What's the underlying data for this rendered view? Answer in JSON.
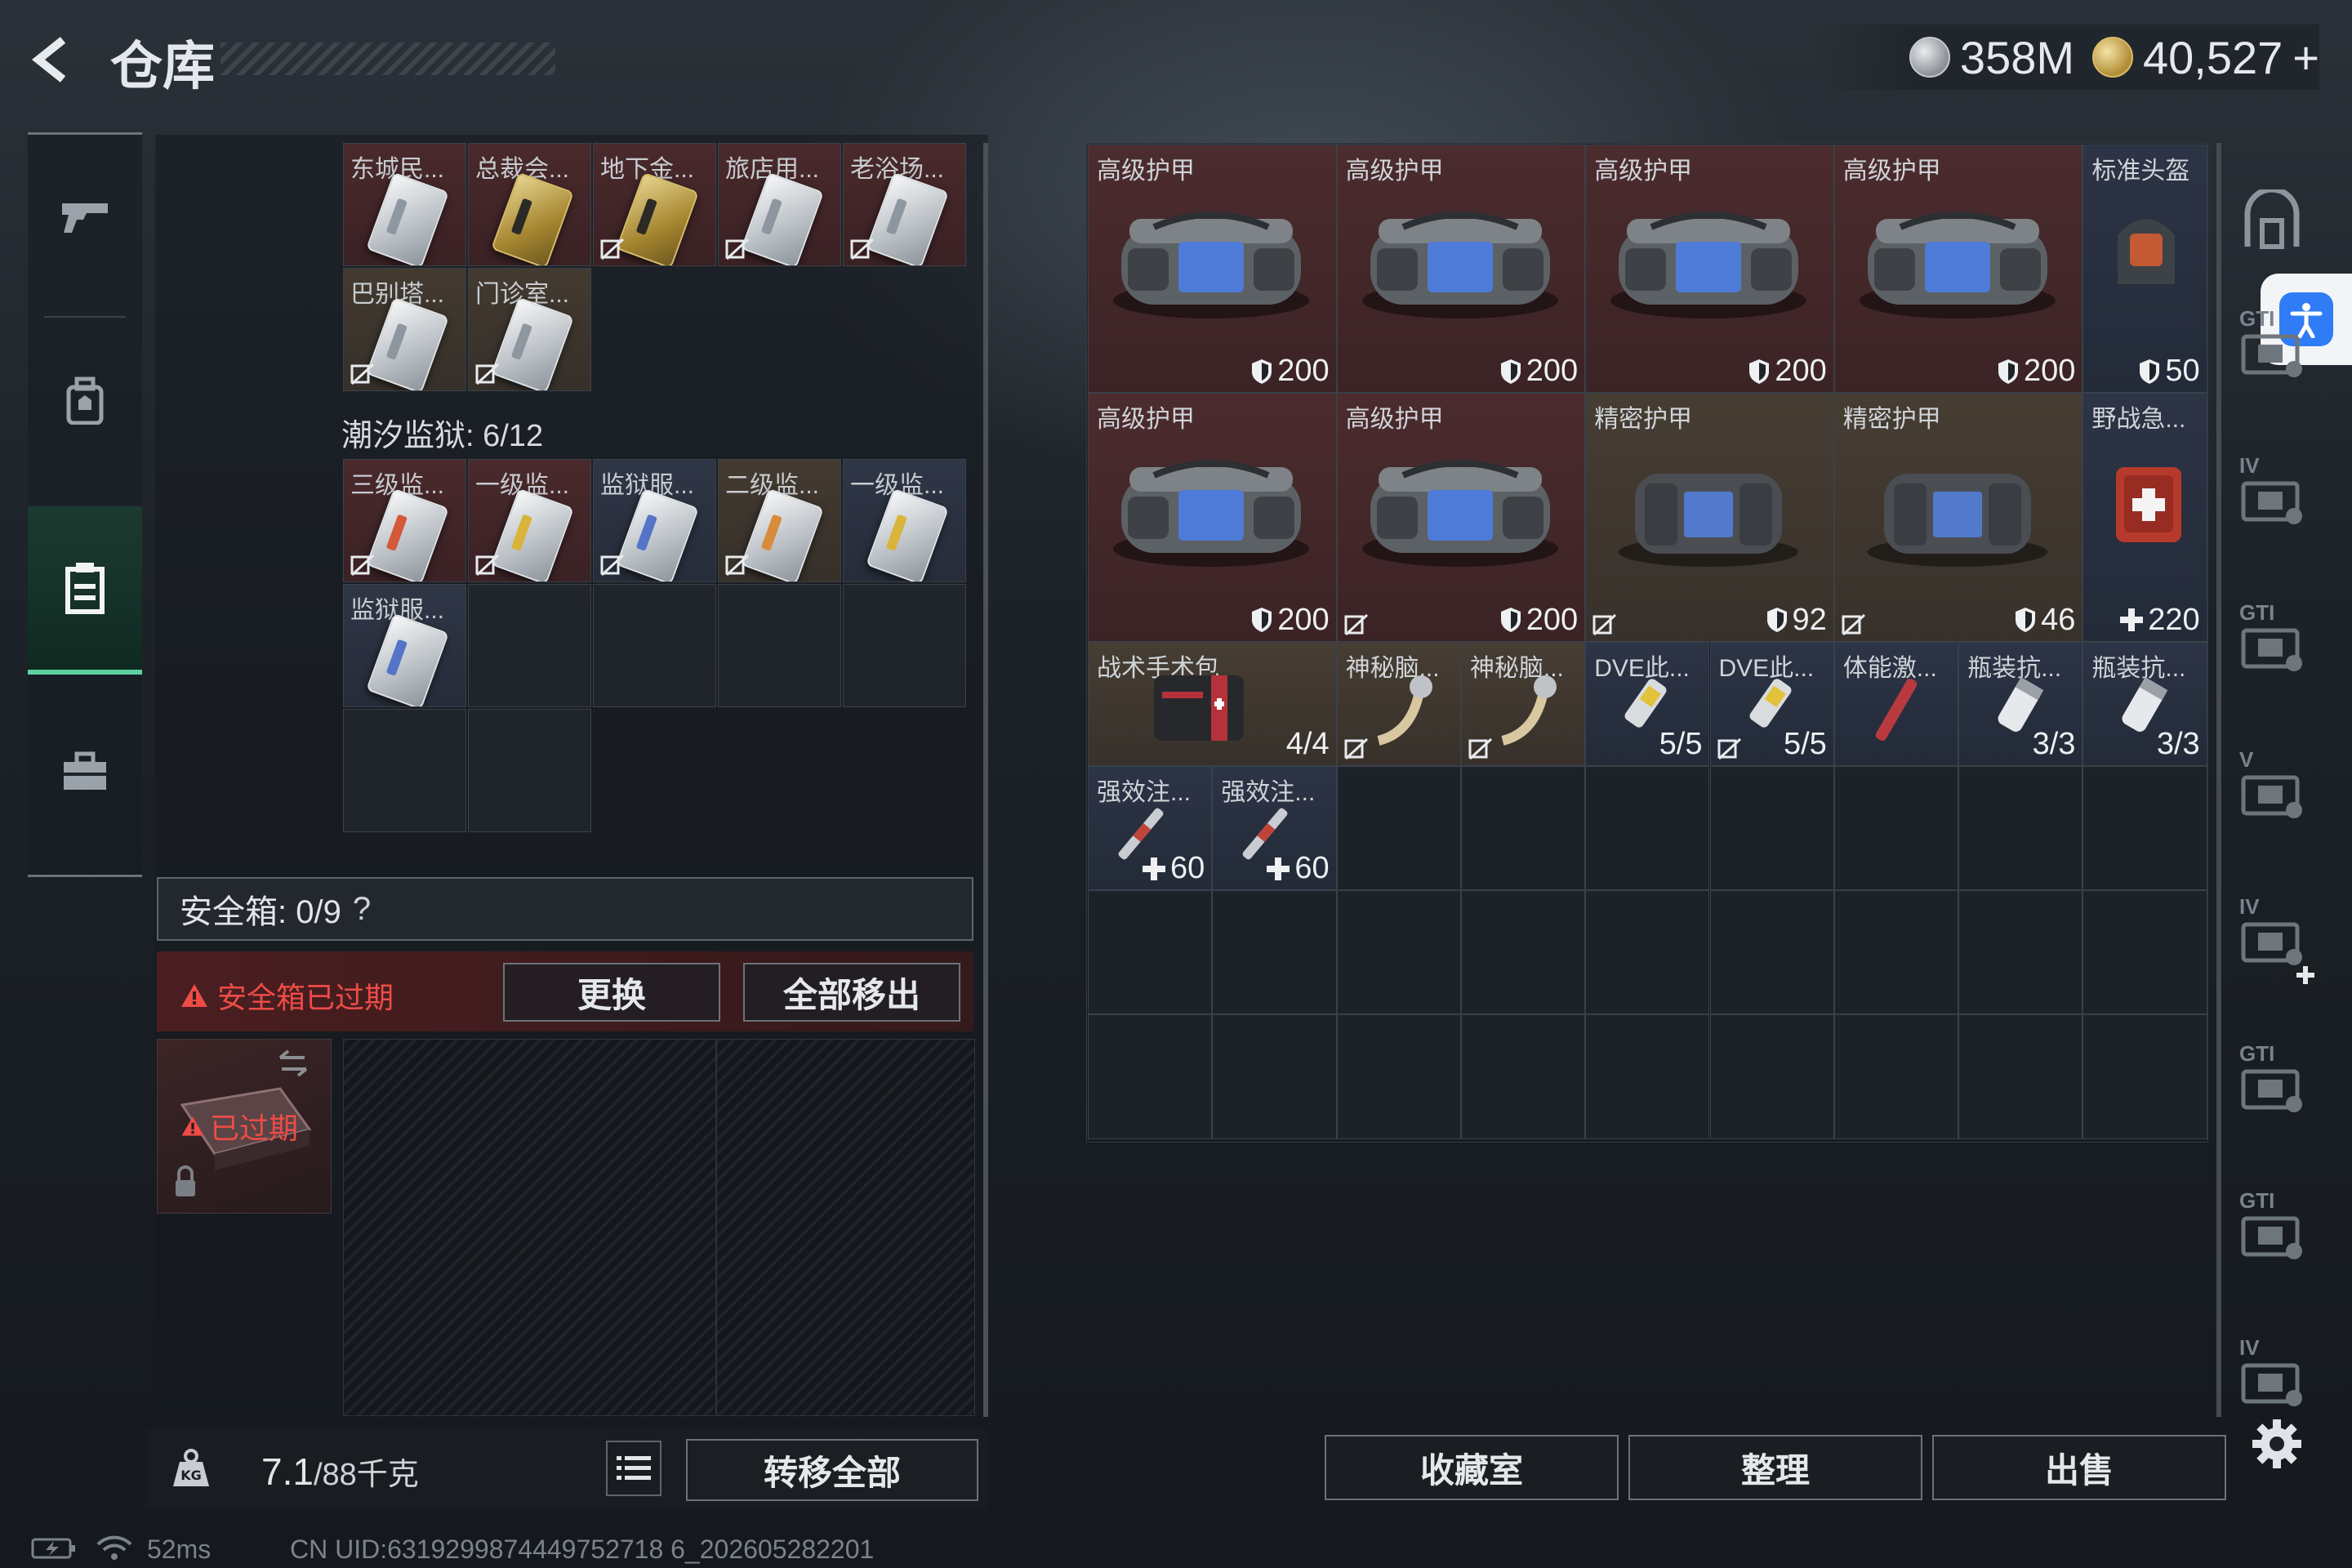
{
  "header": {
    "title": "仓库",
    "currency_silver": "358M",
    "currency_gold": "40,527",
    "gold_plus": "+"
  },
  "left": {
    "keys_top": [
      {
        "label": "东城民...",
        "style": "silver",
        "bg": "red"
      },
      {
        "label": "总裁会...",
        "style": "gold",
        "bg": "red"
      },
      {
        "label": "地下金...",
        "style": "gold",
        "bg": "red"
      },
      {
        "label": "旅店用...",
        "style": "silver",
        "bg": "red"
      },
      {
        "label": "老浴场...",
        "style": "silver",
        "bg": "red"
      },
      {
        "label": "巴别塔...",
        "style": "silver",
        "bg": "brown"
      },
      {
        "label": "门诊室...",
        "style": "silver",
        "bg": "brown"
      }
    ],
    "section_label": "潮汐监狱: 6/12",
    "keys_prison": [
      {
        "label": "三级监...",
        "stripe": "red",
        "bg": "red"
      },
      {
        "label": "一级监...",
        "stripe": "yellow",
        "bg": "red"
      },
      {
        "label": "监狱服...",
        "stripe": "blue",
        "bg": "blue"
      },
      {
        "label": "二级监...",
        "stripe": "orange",
        "bg": "brown"
      },
      {
        "label": "一级监...",
        "stripe": "yellow",
        "bg": "blue"
      },
      {
        "label": "监狱服...",
        "stripe": "blue",
        "bg": "blue"
      }
    ],
    "safe_box_label": "安全箱: 0/9",
    "safe_help": "?",
    "expired_notice": "安全箱已过期",
    "replace_button": "更换",
    "move_all_out_button": "全部移出",
    "case_expired": "已过期",
    "weight_value": "7.1",
    "weight_max": "/88千克",
    "transfer_all_button": "转移全部"
  },
  "stash": {
    "row1": [
      {
        "label": "高级护甲",
        "value": "200",
        "kind": "armor",
        "bg": "red"
      },
      {
        "label": "高级护甲",
        "value": "200",
        "kind": "armor",
        "bg": "red"
      },
      {
        "label": "高级护甲",
        "value": "200",
        "kind": "armor",
        "bg": "red"
      },
      {
        "label": "高级护甲",
        "value": "200",
        "kind": "armor",
        "bg": "red"
      },
      {
        "label": "标准头盔",
        "value": "50",
        "kind": "helmet",
        "bg": "navy"
      }
    ],
    "row2": [
      {
        "label": "高级护甲",
        "value": "200",
        "kind": "armor",
        "bg": "red"
      },
      {
        "label": "高级护甲",
        "value": "200",
        "kind": "armor",
        "bg": "red"
      },
      {
        "label": "精密护甲",
        "value": "92",
        "kind": "armor2",
        "bg": "brown"
      },
      {
        "label": "精密护甲",
        "value": "46",
        "kind": "armor2",
        "bg": "brown"
      },
      {
        "label": "野战急...",
        "value": "220",
        "kind": "medkit",
        "bg": "navy"
      }
    ],
    "row3": [
      {
        "label": "战术手术包",
        "value": "4/4",
        "bg": "brown"
      },
      {
        "label": "神秘脑...",
        "value": "",
        "bg": "brown"
      },
      {
        "label": "神秘脑...",
        "value": "",
        "bg": "brown"
      },
      {
        "label": "DVE此...",
        "value": "5/5",
        "bg": "navy"
      },
      {
        "label": "DVE此...",
        "value": "5/5",
        "bg": "navy"
      },
      {
        "label": "体能激...",
        "value": "",
        "bg": "navy"
      },
      {
        "label": "瓶装抗...",
        "value": "3/3",
        "bg": "navy"
      },
      {
        "label": "瓶装抗...",
        "value": "3/3",
        "bg": "navy"
      }
    ],
    "row4": [
      {
        "label": "强效注...",
        "value": "60",
        "bg": "navy"
      },
      {
        "label": "强效注...",
        "value": "60",
        "bg": "navy"
      }
    ],
    "collection_button": "收藏室",
    "sort_button": "整理",
    "sell_button": "出售"
  },
  "rail": {
    "labels": [
      "GTI",
      "IV",
      "GTI",
      "V",
      "IV",
      "GTI",
      "GTI",
      "IV"
    ]
  },
  "status": {
    "ping": "52ms",
    "uid": "CN UID:6319299874449752718 6_202605282201"
  },
  "colors": {
    "accent_green": "#5fd0a0",
    "expired_red": "#ee4c47",
    "access_blue": "#2f7cf6"
  }
}
